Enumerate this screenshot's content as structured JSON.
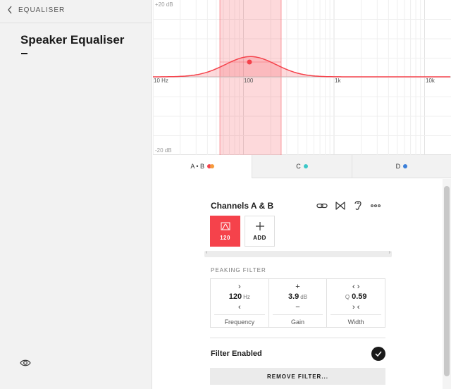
{
  "sidebar": {
    "back_label": "EQUALISER",
    "title": "Speaker Equaliser"
  },
  "graph": {
    "top_label": "+20 dB",
    "bottom_label": "-20 dB",
    "freq_labels": [
      "10 Hz",
      "100",
      "1k",
      "10k"
    ],
    "curve_color": "#f5424b",
    "band_color": "#f5424b"
  },
  "tabs": [
    {
      "label": "A • B",
      "colors": [
        "#f5424b",
        "#f59a3c"
      ],
      "active": true
    },
    {
      "label": "C",
      "colors": [
        "#3cc7c7"
      ],
      "active": false
    },
    {
      "label": "D",
      "colors": [
        "#3a7fd9"
      ],
      "active": false
    }
  ],
  "panel": {
    "channel_title": "Channels A & B",
    "icons": [
      "link-icon",
      "bowtie-icon",
      "ear-icon",
      "more-icon"
    ],
    "filters": [
      {
        "label": "120",
        "icon": "peaking-filter-icon",
        "selected": true
      },
      {
        "label": "ADD",
        "icon": "plus-icon",
        "selected": false
      }
    ],
    "section_label": "PEAKING FILTER",
    "params": {
      "frequency": {
        "value": "120",
        "unit": "Hz",
        "name": "Frequency",
        "up": "›",
        "down": "‹"
      },
      "gain": {
        "value": "3.9",
        "unit": "dB",
        "name": "Gain",
        "up": "+",
        "down": "−"
      },
      "width": {
        "prefix": "Q",
        "value": "0.59",
        "name": "Width",
        "up": "‹ ›",
        "down": "› ‹"
      }
    },
    "filter_enabled_label": "Filter Enabled",
    "filter_enabled": true,
    "remove_label": "REMOVE FILTER..."
  }
}
